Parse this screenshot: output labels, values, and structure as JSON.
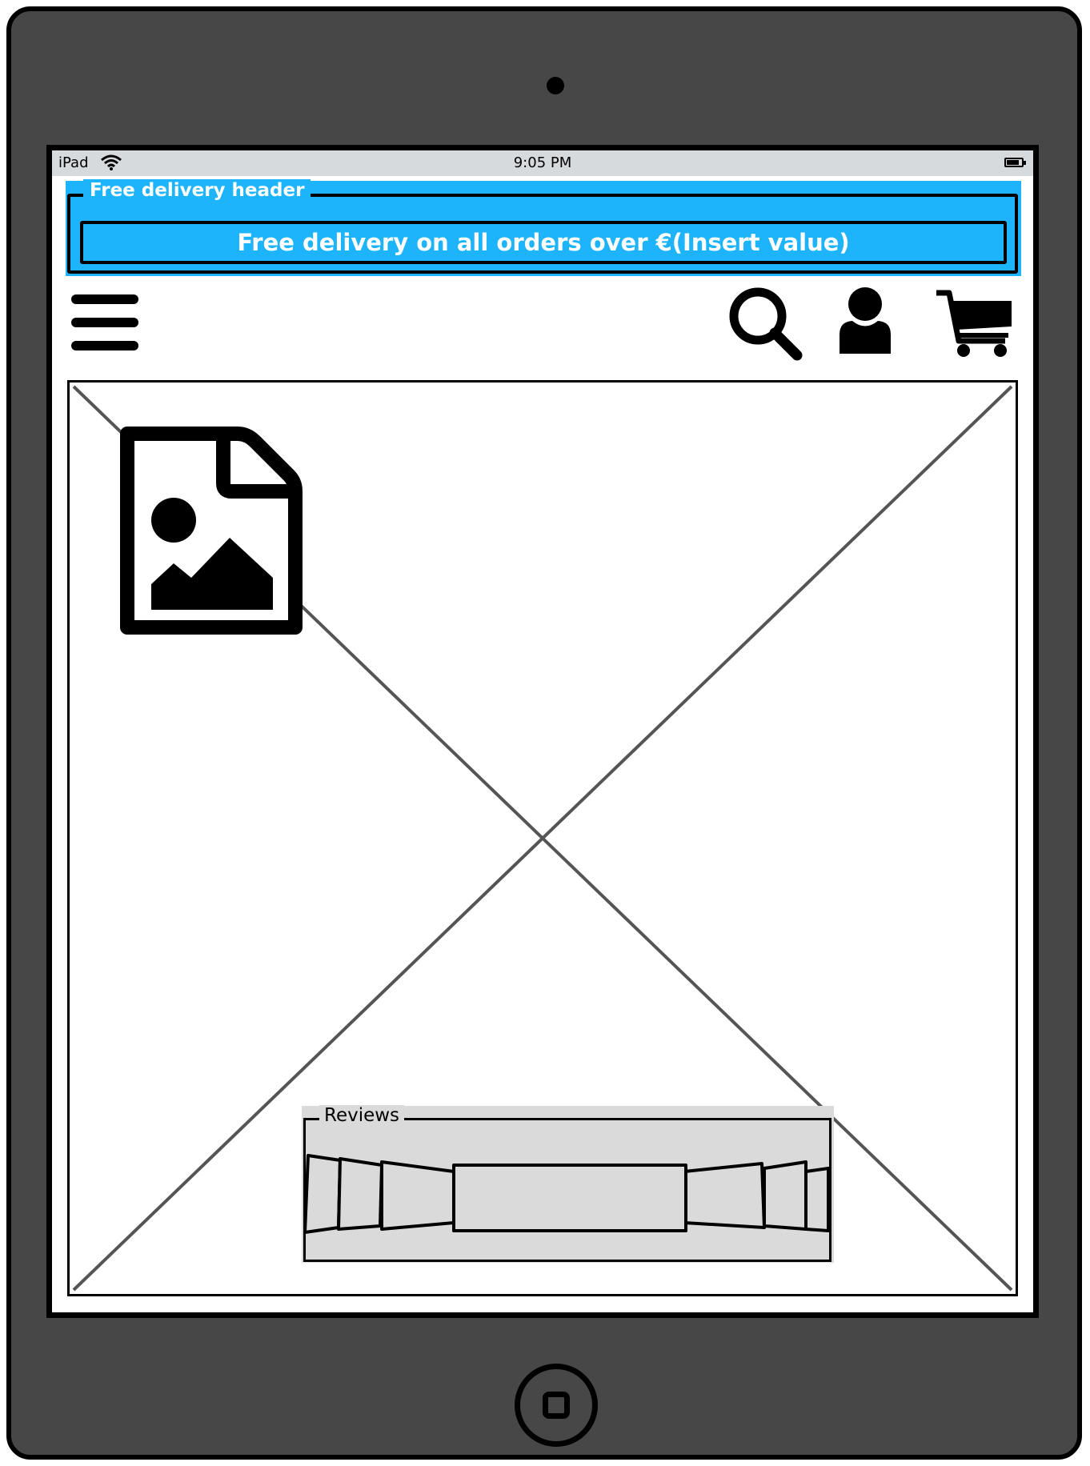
{
  "status_bar": {
    "carrier": "iPad",
    "time": "9:05 PM",
    "wifi_icon": "wifi-icon",
    "battery_icon": "battery-icon"
  },
  "delivery_header": {
    "legend": "Free delivery header",
    "message": "Free delivery on all orders over €(Insert value)",
    "background_color": "#1eb4fb"
  },
  "nav": {
    "menu_icon": "hamburger-menu-icon",
    "search_icon": "search-icon",
    "account_icon": "user-icon",
    "cart_icon": "shopping-cart-icon"
  },
  "hero": {
    "placeholder_icon": "image-file-icon"
  },
  "reviews": {
    "legend": "Reviews",
    "background_color": "#dadada"
  }
}
